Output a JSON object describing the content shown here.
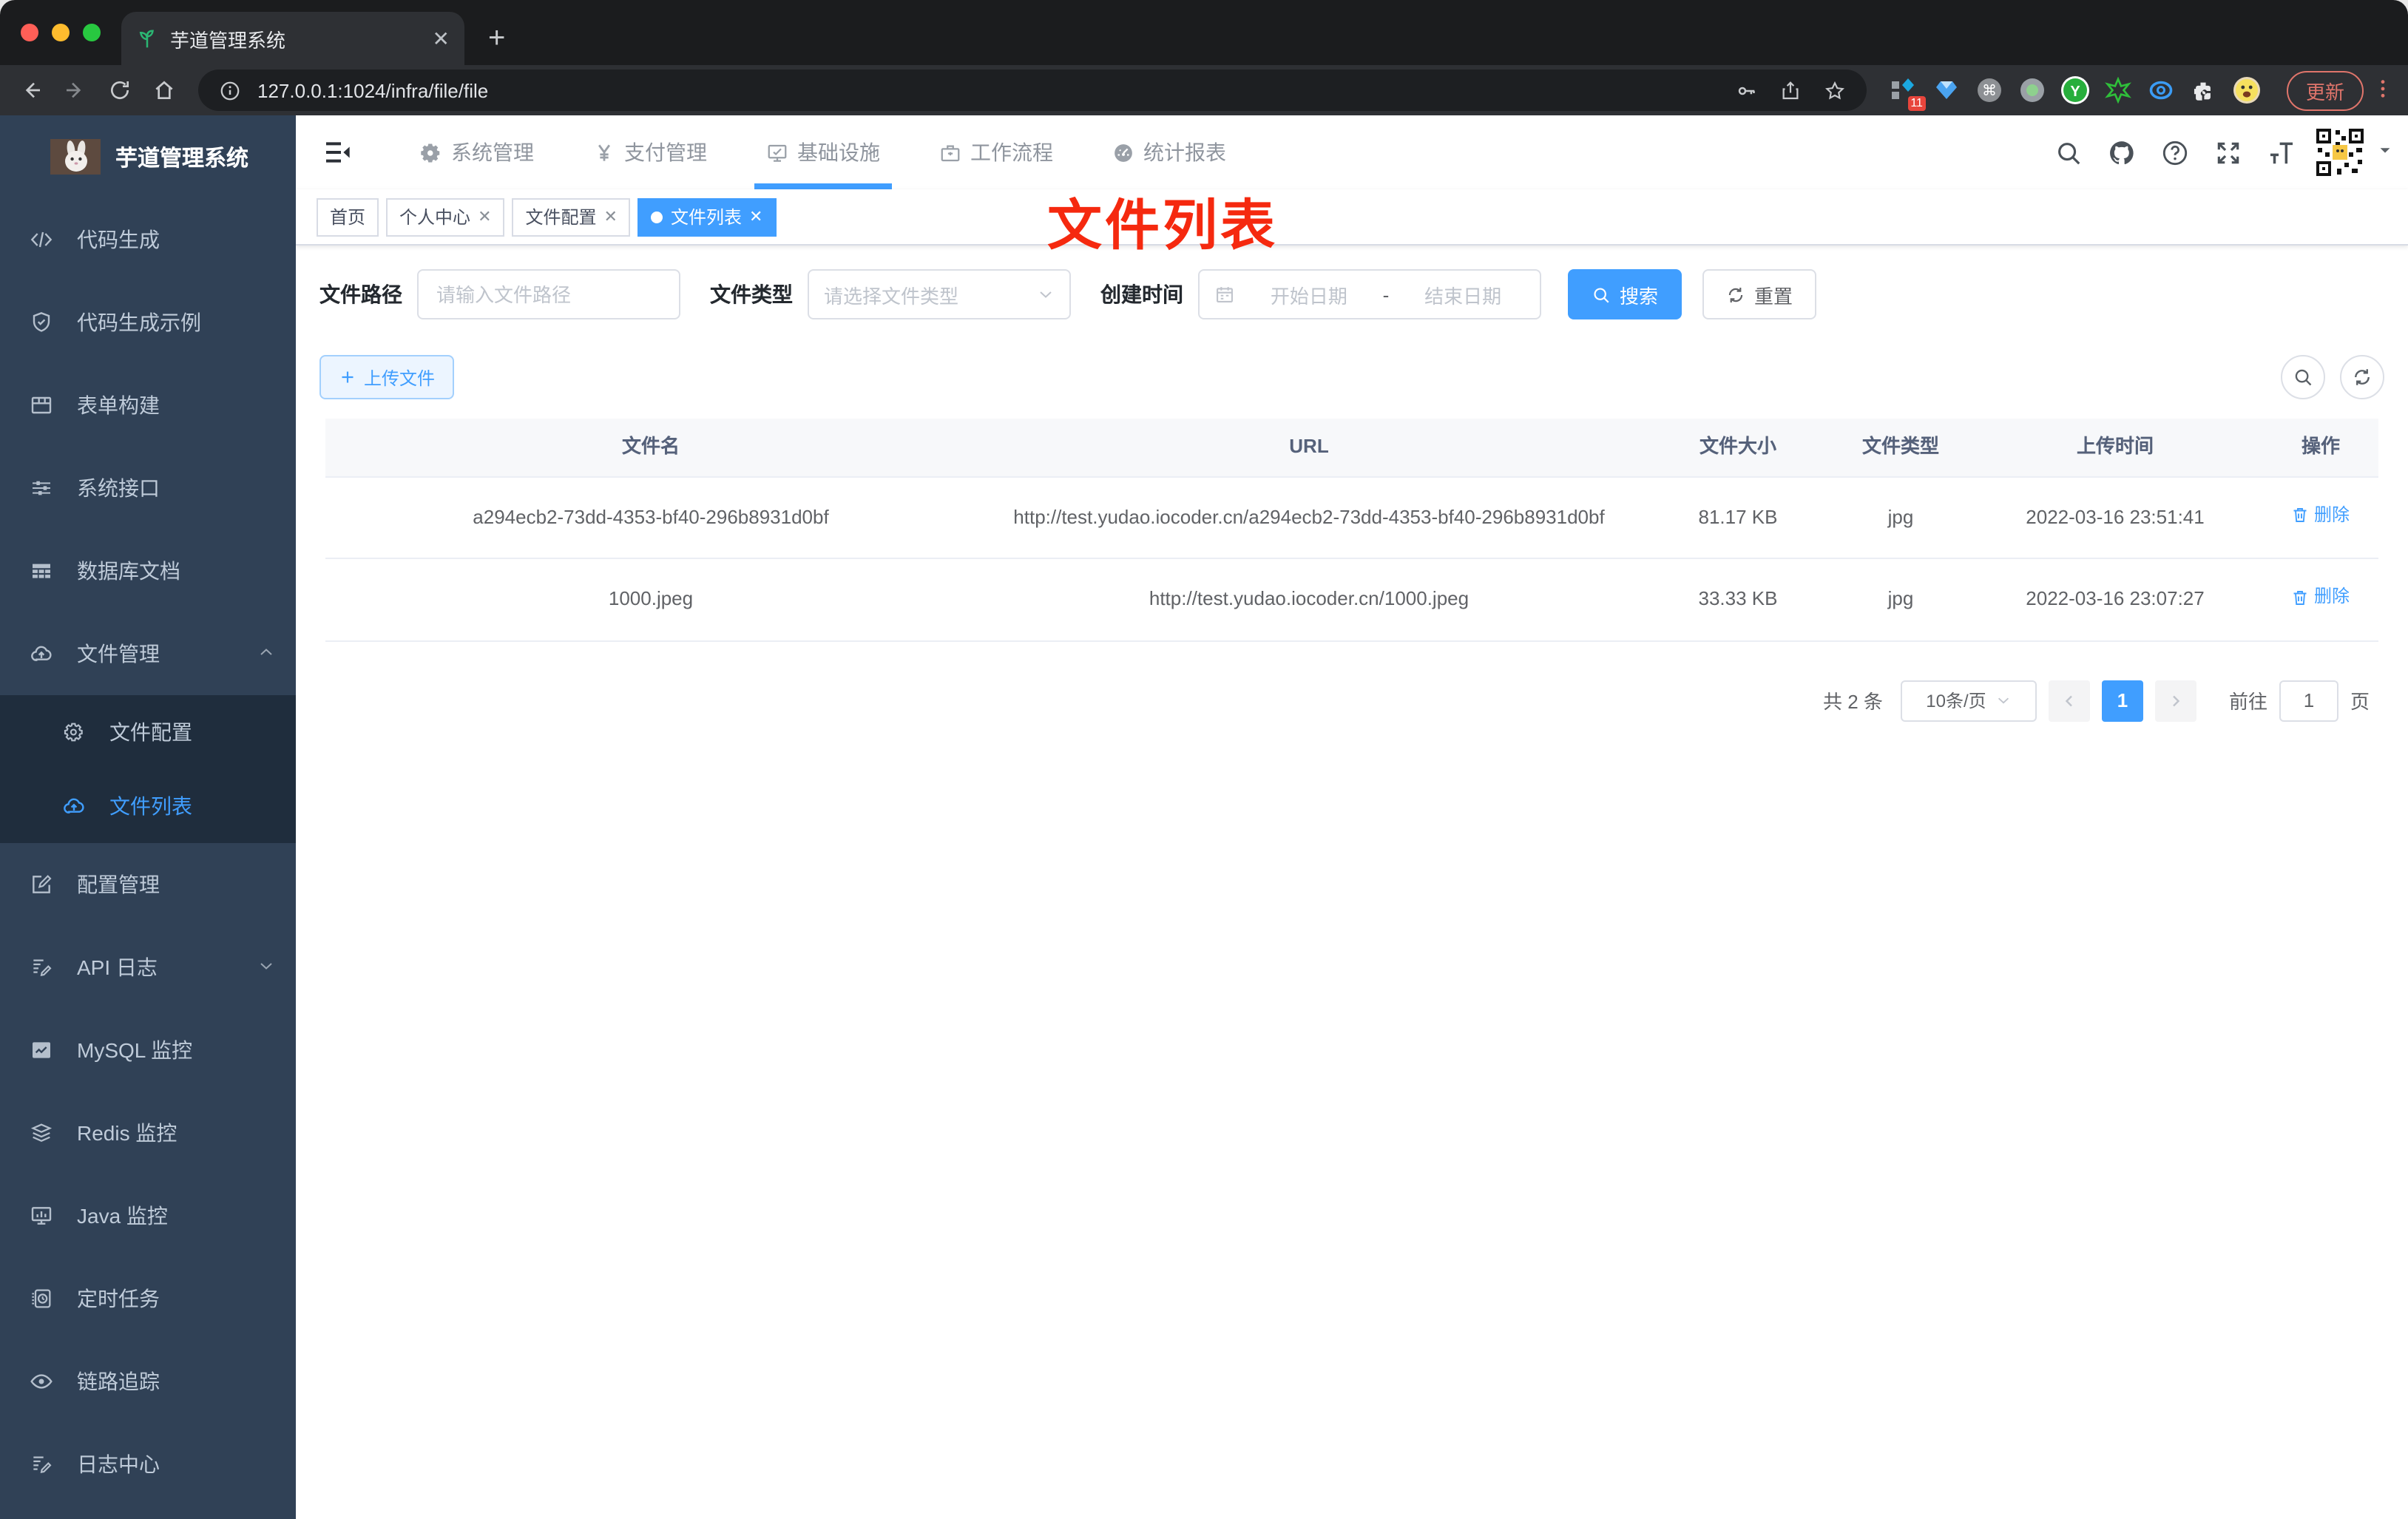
{
  "browser": {
    "tab_title": "芋道管理系统",
    "url": "127.0.0.1:1024/infra/file/file",
    "update_label": "更新",
    "extensions_badge": "11"
  },
  "colors": {
    "accent": "#409eff",
    "sidebar_bg": "#304156",
    "submenu_bg": "#1f2d3d",
    "annotation_red": "#f5290f",
    "tag_active_bg": "#409eff"
  },
  "header": {
    "nav": [
      {
        "label": "系统管理"
      },
      {
        "label": "支付管理"
      },
      {
        "label": "基础设施"
      },
      {
        "label": "工作流程"
      },
      {
        "label": "统计报表"
      }
    ]
  },
  "sidebar": {
    "title": "芋道管理系统",
    "items": [
      {
        "label": "代码生成"
      },
      {
        "label": "代码生成示例"
      },
      {
        "label": "表单构建"
      },
      {
        "label": "系统接口"
      },
      {
        "label": "数据库文档"
      },
      {
        "label": "文件管理"
      },
      {
        "label": "文件配置"
      },
      {
        "label": "文件列表"
      },
      {
        "label": "配置管理"
      },
      {
        "label": "API 日志"
      },
      {
        "label": "MySQL 监控"
      },
      {
        "label": "Redis 监控"
      },
      {
        "label": "Java 监控"
      },
      {
        "label": "定时任务"
      },
      {
        "label": "链路追踪"
      },
      {
        "label": "日志中心"
      }
    ]
  },
  "tags": [
    {
      "label": "首页"
    },
    {
      "label": "个人中心"
    },
    {
      "label": "文件配置"
    },
    {
      "label": "文件列表"
    }
  ],
  "annotation": "文件列表",
  "filters": {
    "path_label": "文件路径",
    "path_placeholder": "请输入文件路径",
    "type_label": "文件类型",
    "type_placeholder": "请选择文件类型",
    "date_label": "创建时间",
    "date_start": "开始日期",
    "date_separator": "-",
    "date_end": "结束日期",
    "search_label": "搜索",
    "reset_label": "重置"
  },
  "toolbar": {
    "upload_label": "上传文件"
  },
  "table": {
    "headers": [
      "文件名",
      "URL",
      "文件大小",
      "文件类型",
      "上传时间",
      "操作"
    ],
    "rows": [
      {
        "name": "a294ecb2-73dd-4353-bf40-296b8931d0bf",
        "url": "http://test.yudao.iocoder.cn/a294ecb2-73dd-4353-bf40-296b8931d0bf",
        "size": "81.17 KB",
        "type": "jpg",
        "time": "2022-03-16 23:51:41",
        "action": "删除"
      },
      {
        "name": "1000.jpeg",
        "url": "http://test.yudao.iocoder.cn/1000.jpeg",
        "size": "33.33 KB",
        "type": "jpg",
        "time": "2022-03-16 23:07:27",
        "action": "删除"
      }
    ]
  },
  "pagination": {
    "total": "共 2 条",
    "per_page": "10条/页",
    "page": "1",
    "goto_label": "前往",
    "goto_value": "1",
    "unit_label": "页"
  }
}
